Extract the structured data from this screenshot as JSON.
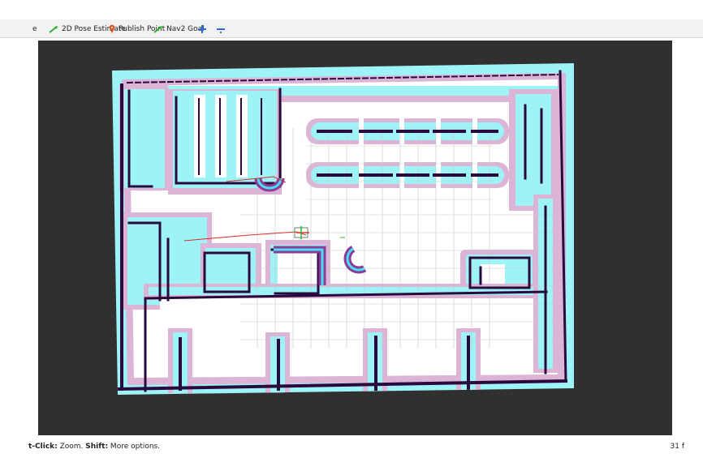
{
  "toolbar": {
    "partial_item": "e",
    "pose_estimate": "2D Pose Estimate",
    "publish_point": "Publish Point",
    "nav_goal": "Nav2 Goal"
  },
  "status": {
    "bold_1": "t-Click:",
    "text_1": " Zoom. ",
    "bold_2": "Shift:",
    "text_2": " More options.",
    "right": "31 f"
  },
  "colors": {
    "viewport_bg": "#303030",
    "map_free": "#ffffff",
    "inflation_outer": "#dbb4d6",
    "inflation_inner": "#9ef3f6",
    "obstacle": "#2a0a3c",
    "high_cost": "#8d3a9a"
  },
  "icons": {
    "pose_estimate": "green-arrow-icon",
    "publish_point": "map-pin-icon",
    "nav_goal": "green-arrow-icon",
    "add": "move-cross-icon",
    "remove": "minus-icon"
  }
}
